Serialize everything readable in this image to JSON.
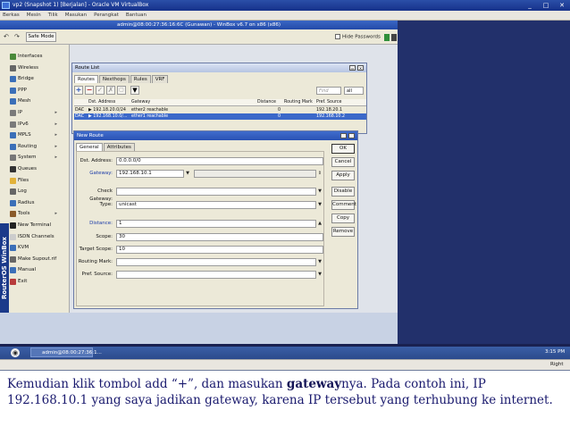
{
  "vbox": {
    "title": "vp2 (Snapshot 1) [Berjalan] - Oracle VM VirtualBox",
    "menu": [
      "Berkas",
      "Mesin",
      "Tilik",
      "Masukan",
      "Perangkat",
      "Bantuan"
    ],
    "window_controls": [
      "_",
      "□",
      "✕"
    ],
    "right_ctrl": "Right Ctrl"
  },
  "winbox": {
    "title": "admin@08:00:27:36:16:6C (Gunawan) - WinBox v6.7 on x86 (x86)",
    "toolbar": {
      "undo": "↶",
      "redo": "↷",
      "safe_mode": "Safe Mode",
      "hide_passwords": "Hide Passwords"
    },
    "side_label": "RouterOS WinBox",
    "menu_items": [
      {
        "label": "Interfaces",
        "color": "#4a8a3a"
      },
      {
        "label": "Wireless",
        "color": "#666666"
      },
      {
        "label": "Bridge",
        "color": "#3b6fb8"
      },
      {
        "label": "PPP",
        "color": "#3b6fb8"
      },
      {
        "label": "Mesh",
        "color": "#3b6fb8"
      },
      {
        "label": "IP",
        "color": "#7a7a7a",
        "arrow": "▸"
      },
      {
        "label": "IPv6",
        "color": "#7a7a7a",
        "arrow": "▸"
      },
      {
        "label": "MPLS",
        "color": "#3b6fb8",
        "arrow": "▸"
      },
      {
        "label": "Routing",
        "color": "#3b6fb8",
        "arrow": "▸"
      },
      {
        "label": "System",
        "color": "#777777",
        "arrow": "▸"
      },
      {
        "label": "Queues",
        "color": "#333333"
      },
      {
        "label": "Files",
        "color": "#e2b23a"
      },
      {
        "label": "Log",
        "color": "#666666"
      },
      {
        "label": "Radius",
        "color": "#3b6fb8"
      },
      {
        "label": "Tools",
        "color": "#8a5a2a",
        "arrow": "▸"
      },
      {
        "label": "New Terminal",
        "color": "#222222"
      },
      {
        "label": "ISDN Channels",
        "color": "#cccccc"
      },
      {
        "label": "KVM",
        "color": "#3b6fb8"
      },
      {
        "label": "Make Supout.rif",
        "color": "#666666"
      },
      {
        "label": "Manual",
        "color": "#3b6fb8"
      },
      {
        "label": "Exit",
        "color": "#b83b3b"
      }
    ]
  },
  "route_list": {
    "title": "Route List",
    "tabs": [
      "Routes",
      "Nexthops",
      "Rules",
      "VRF"
    ],
    "find_placeholder": "Find",
    "filter": "all",
    "columns": [
      "Dst. Address",
      "Gateway",
      "Distance",
      "Routing Mark",
      "Pref. Source"
    ],
    "rows": [
      {
        "flag": "DAC",
        "dst": "▶ 192.18.20.0/24",
        "gateway": "ether2 reachable",
        "distance": "0",
        "mark": "",
        "pref": "192.18.20.1"
      },
      {
        "flag": "DAC",
        "dst": "▶ 192.168.10.0/...",
        "gateway": "ether1 reachable",
        "distance": "0",
        "mark": "",
        "pref": "192.168.10.2"
      }
    ]
  },
  "new_route": {
    "title": "New Route",
    "tabs": [
      "General",
      "Attributes"
    ],
    "fields": {
      "dst_address": {
        "label": "Dst. Address:",
        "value": "0.0.0.0/0"
      },
      "gateway": {
        "label": "Gateway:",
        "value": "192.168.10.1"
      },
      "check_gateway": {
        "label": "Check Gateway:",
        "value": ""
      },
      "type": {
        "label": "Type:",
        "value": "unicast"
      },
      "distance": {
        "label": "Distance:",
        "value": "1"
      },
      "scope": {
        "label": "Scope:",
        "value": "30"
      },
      "target_scope": {
        "label": "Target Scope:",
        "value": "10"
      },
      "routing_mark": {
        "label": "Routing Mark:",
        "value": ""
      },
      "pref_source": {
        "label": "Pref. Source:",
        "value": ""
      }
    },
    "buttons": [
      "OK",
      "Cancel",
      "Apply",
      "Disable",
      "Comment",
      "Copy",
      "Remove"
    ]
  },
  "taskbar": {
    "app": "admin@08:00:27:36:1...",
    "clock": "3:15 PM"
  },
  "caption": {
    "before": "Kemudian klik tombol add “+”, dan masukan ",
    "bold": "gateway",
    "after": "nya. Pada contoh ini, IP 192.168.10.1 yang saya jadikan gateway, karena IP tersebut yang terhubung ke internet."
  }
}
